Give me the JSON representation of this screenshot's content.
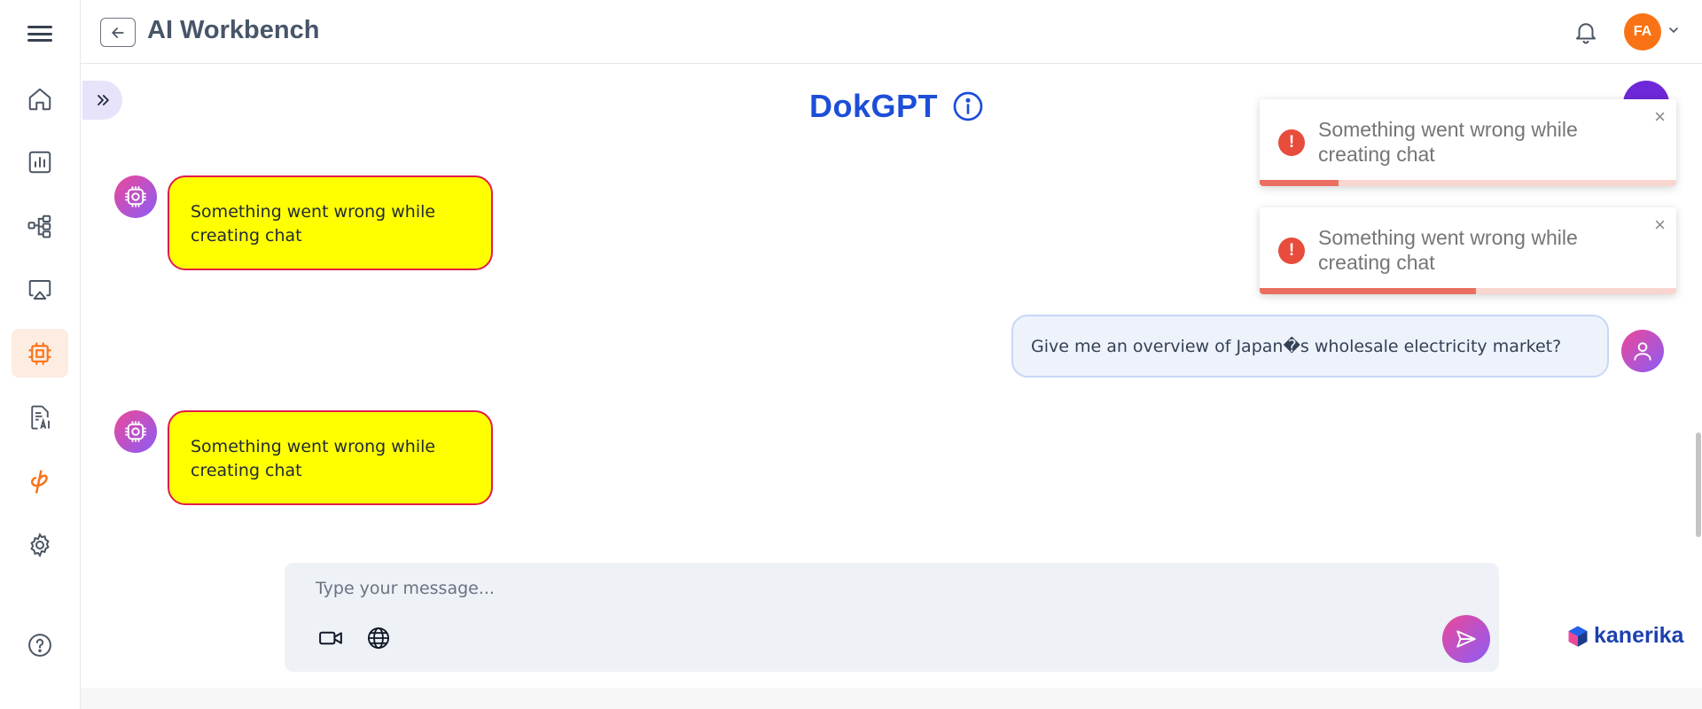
{
  "header": {
    "app_title": "AI Workbench",
    "avatar_initials": "FA"
  },
  "sidebar": {
    "items": [
      {
        "icon": "home-icon"
      },
      {
        "icon": "bar-chart-icon"
      },
      {
        "icon": "workflow-icon"
      },
      {
        "icon": "screen-cast-icon"
      },
      {
        "icon": "chip-icon",
        "active": true
      },
      {
        "icon": "document-ai-icon"
      },
      {
        "icon": "phi-icon"
      },
      {
        "icon": "gear-icon"
      }
    ],
    "help_icon": "help-circle-icon"
  },
  "main": {
    "page_title": "DokGPT",
    "messages": [
      {
        "role": "bot",
        "text": "Something went wrong while creating chat",
        "style": "error"
      },
      {
        "role": "user",
        "text": "Give me an overview of Japan�s wholesale electricity market?"
      },
      {
        "role": "bot",
        "text": "Something went wrong while creating chat",
        "style": "error"
      }
    ],
    "composer": {
      "placeholder": "Type your message..."
    }
  },
  "toasts": [
    {
      "text": "Something went wrong while creating chat",
      "progress": 0.19
    },
    {
      "text": "Something went wrong while creating chat",
      "progress": 0.52
    }
  ],
  "brand": {
    "name": "kanerika"
  },
  "colors": {
    "accent_orange": "#f97316",
    "title_blue": "#1d4ed8",
    "error_bubble_bg": "#ffff00",
    "error_bubble_border": "#e11d48",
    "toast_error": "#e74c3c",
    "avatar_gradient_start": "#ec4899",
    "avatar_gradient_end": "#8b5cf6"
  }
}
